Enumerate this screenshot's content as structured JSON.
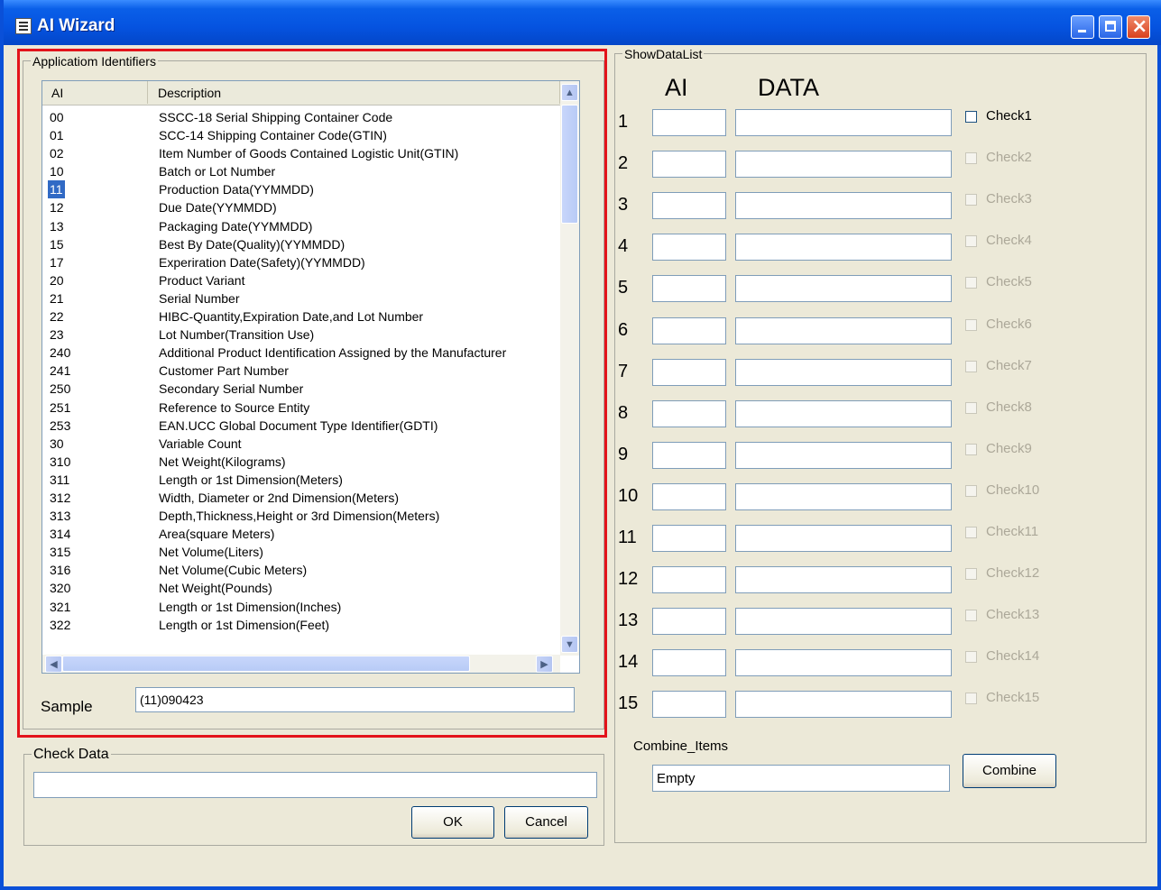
{
  "window": {
    "title": "AI Wizard"
  },
  "app_group": {
    "label": "Applicatiom Identifiers"
  },
  "listview": {
    "headers": {
      "ai": "AI",
      "description": "Description"
    },
    "rows": [
      {
        "ai": "00",
        "desc": "SSCC-18 Serial Shipping Container Code"
      },
      {
        "ai": "01",
        "desc": "SCC-14 Shipping Container Code(GTIN)"
      },
      {
        "ai": "02",
        "desc": "Item Number of Goods Contained Logistic Unit(GTIN)"
      },
      {
        "ai": "10",
        "desc": "Batch or Lot Number"
      },
      {
        "ai": "11",
        "desc": "Production Data(YYMMDD)"
      },
      {
        "ai": "12",
        "desc": "Due Date(YYMMDD)"
      },
      {
        "ai": "13",
        "desc": "Packaging Date(YYMMDD)"
      },
      {
        "ai": "15",
        "desc": "Best By Date(Quality)(YYMMDD)"
      },
      {
        "ai": "17",
        "desc": "Experiration Date(Safety)(YYMMDD)"
      },
      {
        "ai": "20",
        "desc": "Product Variant"
      },
      {
        "ai": "21",
        "desc": "Serial Number"
      },
      {
        "ai": "22",
        "desc": "HIBC-Quantity,Expiration Date,and Lot Number"
      },
      {
        "ai": "23",
        "desc": "Lot Number(Transition Use)"
      },
      {
        "ai": "240",
        "desc": "Additional Product Identification Assigned by the Manufacturer"
      },
      {
        "ai": "241",
        "desc": "Customer Part Number"
      },
      {
        "ai": "250",
        "desc": "Secondary Serial Number"
      },
      {
        "ai": "251",
        "desc": "Reference to Source Entity"
      },
      {
        "ai": "253",
        "desc": "EAN.UCC Global Document Type Identifier(GDTI)"
      },
      {
        "ai": "30",
        "desc": "Variable Count"
      },
      {
        "ai": "310",
        "desc": "Net Weight(Kilograms)"
      },
      {
        "ai": "311",
        "desc": "Length or 1st Dimension(Meters)"
      },
      {
        "ai": "312",
        "desc": "Width, Diameter or 2nd Dimension(Meters)"
      },
      {
        "ai": "313",
        "desc": "Depth,Thickness,Height or 3rd Dimension(Meters)"
      },
      {
        "ai": "314",
        "desc": "Area(square Meters)"
      },
      {
        "ai": "315",
        "desc": "Net Volume(Liters)"
      },
      {
        "ai": "316",
        "desc": "Net Volume(Cubic Meters)"
      },
      {
        "ai": "320",
        "desc": "Net Weight(Pounds)"
      },
      {
        "ai": "321",
        "desc": "Length or 1st Dimension(Inches)"
      },
      {
        "ai": "322",
        "desc": "Length or 1st Dimension(Feet)"
      }
    ],
    "selected_ai": "11"
  },
  "sample": {
    "label": "Sample",
    "value": "(11)090423"
  },
  "check_data": {
    "label": "Check Data",
    "value": ""
  },
  "buttons": {
    "ok": "OK",
    "cancel": "Cancel",
    "combine": "Combine"
  },
  "show_data_list": {
    "label": "ShowDataList",
    "ai_header": "AI",
    "data_header": "DATA",
    "rows": [
      {
        "num": "1",
        "check": "Check1",
        "enabled": true
      },
      {
        "num": "2",
        "check": "Check2",
        "enabled": false
      },
      {
        "num": "3",
        "check": "Check3",
        "enabled": false
      },
      {
        "num": "4",
        "check": "Check4",
        "enabled": false
      },
      {
        "num": "5",
        "check": "Check5",
        "enabled": false
      },
      {
        "num": "6",
        "check": "Check6",
        "enabled": false
      },
      {
        "num": "7",
        "check": "Check7",
        "enabled": false
      },
      {
        "num": "8",
        "check": "Check8",
        "enabled": false
      },
      {
        "num": "9",
        "check": "Check9",
        "enabled": false
      },
      {
        "num": "10",
        "check": "Check10",
        "enabled": false
      },
      {
        "num": "11",
        "check": "Check11",
        "enabled": false
      },
      {
        "num": "12",
        "check": "Check12",
        "enabled": false
      },
      {
        "num": "13",
        "check": "Check13",
        "enabled": false
      },
      {
        "num": "14",
        "check": "Check14",
        "enabled": false
      },
      {
        "num": "15",
        "check": "Check15",
        "enabled": false
      }
    ]
  },
  "combine_items": {
    "label": "Combine_Items",
    "value": "Empty"
  },
  "colors": {
    "titlebar": "#0553e0",
    "highlight": "#e3131b",
    "selection": "#316ac5",
    "disabled_text": "#aca899"
  }
}
